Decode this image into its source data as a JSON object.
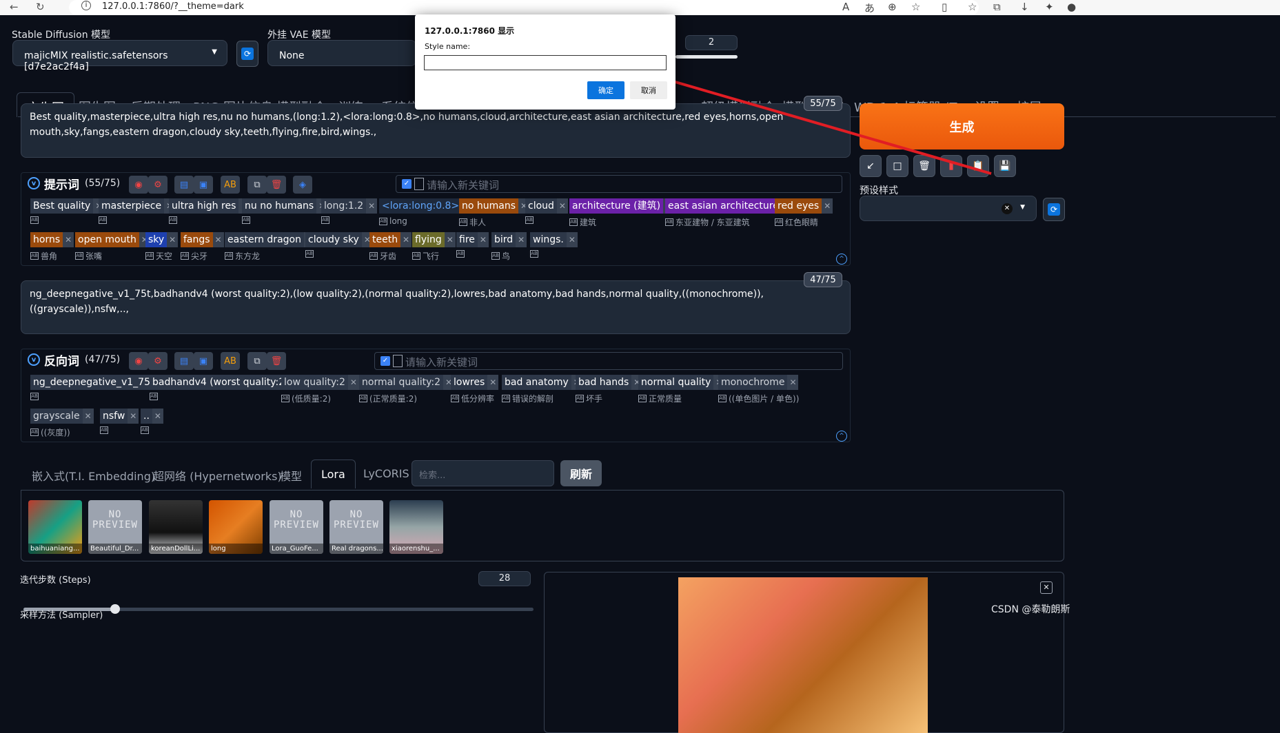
{
  "browser": {
    "url": "127.0.0.1:7860/?__theme=dark"
  },
  "models": {
    "sd_label": "Stable Diffusion 模型",
    "sd_value": "majicMIX realistic.safetensors [d7e2ac2f4a]",
    "vae_label": "外挂 VAE 模型",
    "vae_value": "None",
    "clip_value": "2"
  },
  "tabs": [
    "文生图",
    "图生图",
    "后期处理",
    "PNG 图片信息",
    "模型融合",
    "训练",
    "系统信息",
    "超级模型融合",
    "模型工具箱",
    "WD 1.4 标签器 (Tagger)",
    "设置",
    "扩展"
  ],
  "prompt": {
    "text": "Best quality,masterpiece,ultra high res,nu no humans,(long:1.2),<lora:long:0.8>,no humans,cloud,architecture,east asian architecture,red eyes,horns,open mouth,sky,fangs,eastern dragon,cloudy sky,teeth,flying,fire,bird,wings.,",
    "counter": "55/75"
  },
  "prompt_panel": {
    "title": "提示词",
    "count": "(55/75)",
    "placeholder": "请输入新关键词",
    "tags": [
      {
        "text": "Best quality",
        "tr": ""
      },
      {
        "text": "masterpiece",
        "tr": ""
      },
      {
        "text": "ultra high res",
        "tr": ""
      },
      {
        "text": "nu no humans",
        "tr": ""
      },
      {
        "text": "long:1.2",
        "tr": ""
      },
      {
        "text": "<lora:long:0.8>",
        "tr": "long"
      },
      {
        "text": "no humans",
        "tr": "非人"
      },
      {
        "text": "cloud",
        "tr": ""
      },
      {
        "text": "architecture (建筑)",
        "tr": "建筑"
      },
      {
        "text": "east asian architecture",
        "tr": "东亚建物 / 东亚建筑"
      },
      {
        "text": "red eyes",
        "tr": "红色眼睛"
      },
      {
        "text": "horns",
        "tr": "兽角"
      },
      {
        "text": "open mouth",
        "tr": "张嘴"
      },
      {
        "text": "sky",
        "tr": "天空"
      },
      {
        "text": "fangs",
        "tr": "尖牙"
      },
      {
        "text": "eastern dragon",
        "tr": "东方龙"
      },
      {
        "text": "cloudy sky",
        "tr": ""
      },
      {
        "text": "teeth",
        "tr": "牙齿"
      },
      {
        "text": "flying",
        "tr": "飞行"
      },
      {
        "text": "fire",
        "tr": ""
      },
      {
        "text": "bird",
        "tr": "鸟"
      },
      {
        "text": "wings.",
        "tr": ""
      }
    ]
  },
  "negative": {
    "text": "ng_deepnegative_v1_75t,badhandv4 (worst quality:2),(low quality:2),(normal quality:2),lowres,bad anatomy,bad hands,normal quality,((monochrome)),((grayscale)),nsfw,..,",
    "counter": "47/75"
  },
  "negative_panel": {
    "title": "反向词",
    "count": "(47/75)",
    "placeholder": "请输入新关键词",
    "tags": [
      {
        "text": "ng_deepnegative_v1_75t",
        "tr": ""
      },
      {
        "text": "badhandv4 (worst quality:2)",
        "tr": ""
      },
      {
        "text": "low quality:2",
        "tr": "(低质量:2)"
      },
      {
        "text": "normal quality:2",
        "tr": "(正常质量:2)"
      },
      {
        "text": "lowres",
        "tr": "低分辨率"
      },
      {
        "text": "bad anatomy",
        "tr": "错误的解剖"
      },
      {
        "text": "bad hands",
        "tr": "坏手"
      },
      {
        "text": "normal quality",
        "tr": "正常质量"
      },
      {
        "text": "monochrome",
        "tr": "((单色图片 / 单色))"
      },
      {
        "text": "grayscale",
        "tr": "((灰度))"
      },
      {
        "text": "nsfw",
        "tr": ""
      },
      {
        "text": "..",
        "tr": ""
      }
    ]
  },
  "generate_label": "生成",
  "preset_label": "预设样式",
  "network_tabs": [
    "嵌入式(T.I. Embedding)",
    "超网络 (Hypernetworks)",
    "模型",
    "Lora",
    "LyCORIS"
  ],
  "network_search_placeholder": "检索...",
  "refresh_label": "刷新",
  "no_preview_text": "NO PREVIEW",
  "cards": [
    "baihuaniang...",
    "Beautiful_Dr...",
    "koreanDollLi...",
    "long",
    "Lora_GuoFe...",
    "Real dragons...",
    "xiaorenshu_..."
  ],
  "steps": {
    "label": "迭代步数 (Steps)",
    "value": "28",
    "fraction": 0.18
  },
  "sampler_label": "采样方法 (Sampler)",
  "dialog": {
    "title": "127.0.0.1:7860 显示",
    "label": "Style name:",
    "ok": "确定",
    "cancel": "取消"
  },
  "watermark": "CSDN @泰勒朗斯",
  "colors": {
    "generate": "#ea580c",
    "accent": "#0b74de",
    "arrow": "#e11d24"
  }
}
